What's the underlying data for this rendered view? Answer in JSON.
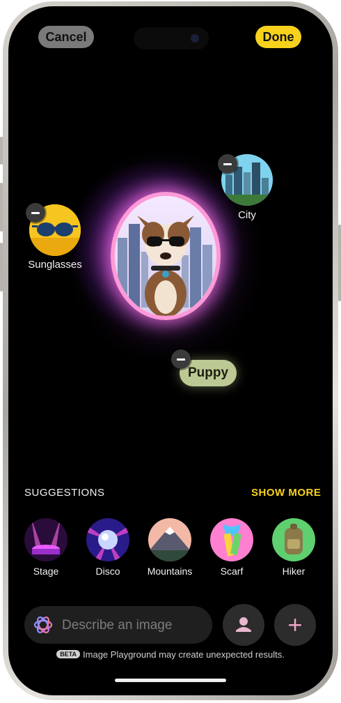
{
  "header": {
    "cancel_label": "Cancel",
    "done_label": "Done"
  },
  "canvas": {
    "concepts": [
      {
        "label": "Sunglasses"
      },
      {
        "label": "City"
      },
      {
        "label": "Puppy"
      }
    ]
  },
  "suggestions": {
    "title": "SUGGESTIONS",
    "show_more_label": "SHOW MORE",
    "items": [
      {
        "label": "Stage"
      },
      {
        "label": "Disco"
      },
      {
        "label": "Mountains"
      },
      {
        "label": "Scarf"
      },
      {
        "label": "Hiker"
      }
    ]
  },
  "prompt": {
    "placeholder": "Describe an image"
  },
  "footer": {
    "beta_badge": "BETA",
    "disclaimer": "Image Playground may create unexpected results."
  },
  "colors": {
    "accent": "#f7d21c",
    "glow": "#ff66cc",
    "background": "#000000"
  },
  "icons": {
    "prompt": "apple-intelligence-icon",
    "person": "person-icon",
    "add": "plus-icon",
    "remove": "minus-icon"
  }
}
